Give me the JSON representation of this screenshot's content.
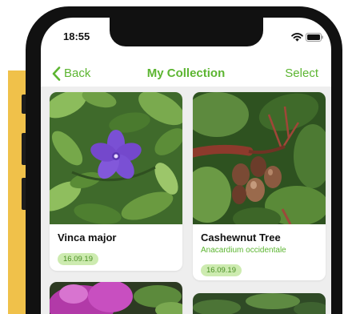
{
  "status_bar": {
    "time": "18:55",
    "icons": [
      "wifi-icon",
      "battery-icon"
    ]
  },
  "nav": {
    "back_icon": "chevron-left-icon",
    "back_label": "Back",
    "title": "My Collection",
    "select_label": "Select"
  },
  "cards": [
    {
      "name": "Vinca major",
      "date": "16.09.19"
    },
    {
      "name": "Cashewnut Tree",
      "scientific_name": "Anacardium occidentale",
      "date": "16.09.19"
    }
  ],
  "colors": {
    "accent": "#5cb531",
    "badge_bg": "#cdebb0",
    "badge_text": "#4a8f24",
    "content_bg": "#eeeeee",
    "frame": "#111111",
    "decor_yellow": "#f0c14a"
  }
}
